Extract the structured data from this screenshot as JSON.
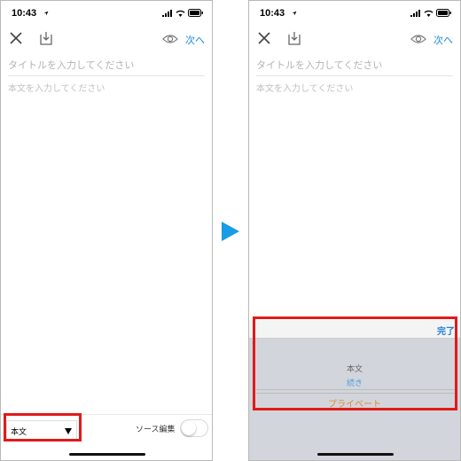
{
  "left_screen": {
    "time": "10:43",
    "toolbar": {
      "next_label": "次へ"
    },
    "title_placeholder": "タイトルを入力してください",
    "body_placeholder": "本文を入力してください",
    "format_select": {
      "value": "本文"
    },
    "source_edit_label": "ソース編集",
    "source_edit_enabled": false
  },
  "right_screen": {
    "time": "10:43",
    "toolbar": {
      "next_label": "次へ"
    },
    "title_placeholder": "タイトルを入力してください",
    "body_placeholder": "本文を入力してください",
    "picker": {
      "done_label": "完了",
      "options": [
        "本文",
        "続き",
        "プライベート"
      ]
    }
  },
  "colors": {
    "accent": "#1d8ae0",
    "highlight": "#e11a1a",
    "arrow": "#1a9be6",
    "private_option": "#e38a33"
  },
  "icons": [
    "location-arrow-icon",
    "signal-icon",
    "wifi-icon",
    "battery-icon",
    "close-icon",
    "save-icon",
    "eye-icon",
    "caret-down-icon",
    "arrow-right-icon"
  ]
}
